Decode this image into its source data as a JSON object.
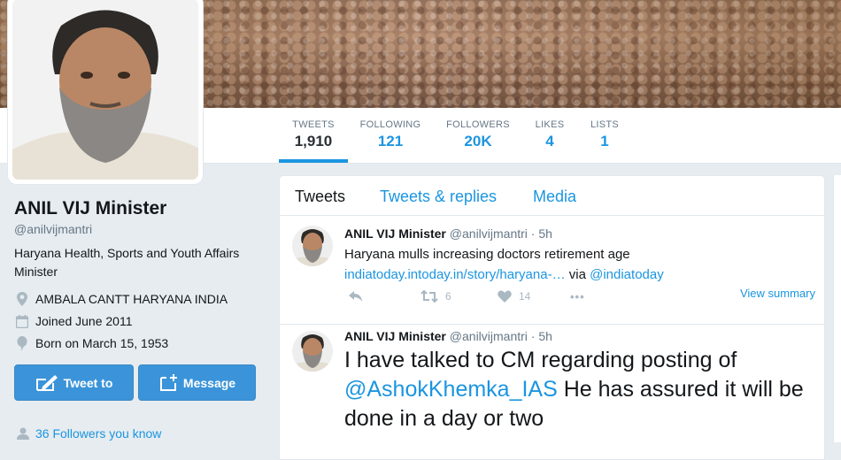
{
  "profile": {
    "name": "ANIL VIJ Minister",
    "handle": "@anilvijmantri",
    "bio": "Haryana Health, Sports and Youth Affairs Minister",
    "location": "AMBALA CANTT HARYANA INDIA",
    "joined": "Joined June 2011",
    "born": "Born on March 15, 1953",
    "followers_you_know": "36 Followers you know"
  },
  "buttons": {
    "tweet_to": "Tweet to",
    "message": "Message"
  },
  "stats": [
    {
      "label": "TWEETS",
      "value": "1,910"
    },
    {
      "label": "FOLLOWING",
      "value": "121"
    },
    {
      "label": "FOLLOWERS",
      "value": "20K"
    },
    {
      "label": "LIKES",
      "value": "4"
    },
    {
      "label": "LISTS",
      "value": "1"
    }
  ],
  "tabs": [
    "Tweets",
    "Tweets & replies",
    "Media"
  ],
  "tweets": [
    {
      "name": "ANIL VIJ Minister",
      "handle": "@anilvijmantri",
      "time": "· 5h",
      "text": "Haryana mulls increasing doctors retirement age ",
      "link": "indiatoday.intoday.in/story/haryana-…",
      "via": " via ",
      "mention": "@indiatoday",
      "retweets": "6",
      "likes": "14",
      "more": "•••",
      "view_summary": "View summary"
    },
    {
      "name": "ANIL VIJ Minister",
      "handle": "@anilvijmantri",
      "time": "· 5h",
      "text_before": "I have talked to CM regarding posting of ",
      "mention": "@AshokKhemka_IAS",
      "text_after": " He has assured it will be done in a day or two"
    }
  ],
  "colors": {
    "accent": "#1b95e0",
    "button": "#3b94d9",
    "background": "#e6ecf0"
  }
}
